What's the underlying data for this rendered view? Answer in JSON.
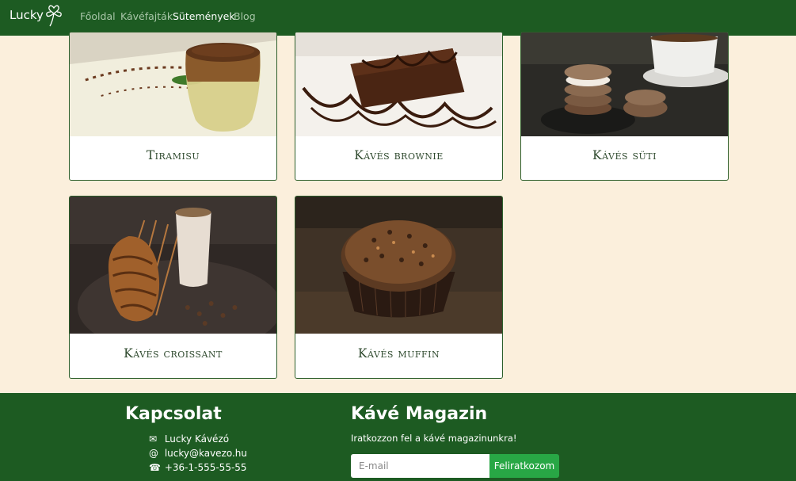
{
  "navbar": {
    "brand": "Lucky",
    "links": [
      {
        "label": "Főoldal",
        "active": false
      },
      {
        "label": "Kávéfajták",
        "active": false
      },
      {
        "label": "Sütemények",
        "active": true
      },
      {
        "label": "Blog",
        "active": false
      }
    ]
  },
  "products": [
    {
      "name": "Tiramisu",
      "image": "tiramisu-glass"
    },
    {
      "name": "Kávés brownie",
      "image": "brownie-slice"
    },
    {
      "name": "Kávés süti",
      "image": "sandwich-cookies"
    },
    {
      "name": "Kávés croissant",
      "image": "croissant-and-coffee"
    },
    {
      "name": "Kávés muffin",
      "image": "chocolate-muffin"
    }
  ],
  "footer": {
    "contact": {
      "heading": "Kapcsolat",
      "name": "Lucky Kávézó",
      "email": "lucky@kavezo.hu",
      "phone": "+36-1-555-55-55"
    },
    "magazine": {
      "heading": "Kávé Magazin",
      "text": "Iratkozzon fel a kávé magazinunkra!",
      "email_placeholder": "E-mail",
      "button": "Feliratkozom"
    }
  },
  "colors": {
    "nav_bg": "#1d5b22",
    "page_bg": "#fbefdc",
    "button": "#28a745"
  }
}
